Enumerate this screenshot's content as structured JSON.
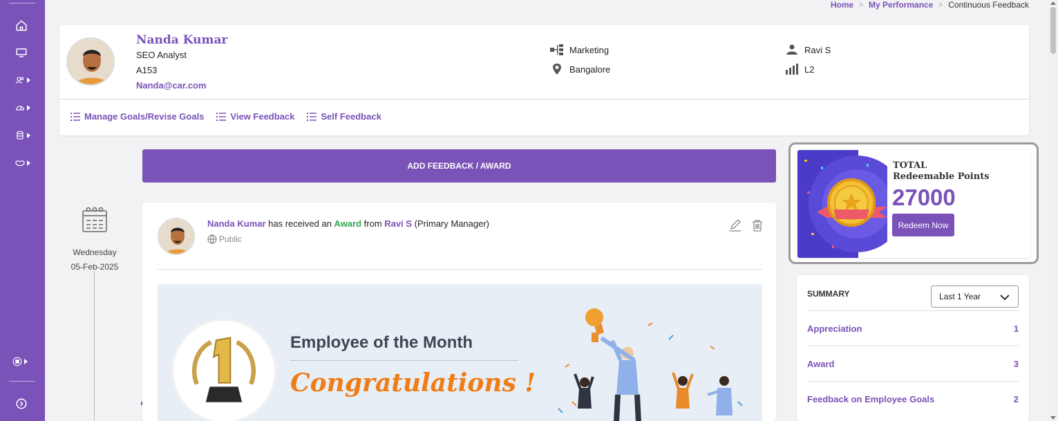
{
  "breadcrumb": {
    "home": "Home",
    "section": "My Performance",
    "current": "Continuous Feedback"
  },
  "profile": {
    "name": "Nanda Kumar",
    "role": "SEO Analyst",
    "id": "A153",
    "email": "Nanda@car.com",
    "department": "Marketing",
    "location": "Bangalore",
    "manager": "Ravi S",
    "level": "L2"
  },
  "profile_links": {
    "manage_goals": "Manage Goals/Revise Goals",
    "view_feedback": "View Feedback",
    "self_feedback": "Self Feedback"
  },
  "add_feedback_label": "ADD FEEDBACK / AWARD",
  "timeline": {
    "weekday": "Wednesday",
    "date": "05-Feb-2025"
  },
  "feed": {
    "recipient": "Nanda Kumar",
    "text1": " has received an ",
    "type": "Award",
    "text2": " from ",
    "giver": "Ravi S",
    "giver_role": " (Primary Manager)",
    "visibility": "Public",
    "banner_title": "Employee of the Month",
    "banner_message": "Congratulations !"
  },
  "points": {
    "label1": "TOTAL",
    "label2": "Redeemable Points",
    "value": "27000",
    "redeem_label": "Redeem Now"
  },
  "summary": {
    "title": "SUMMARY",
    "period": "Last 1 Year",
    "rows": [
      {
        "label": "Appreciation",
        "count": "1"
      },
      {
        "label": "Award",
        "count": "3"
      },
      {
        "label": "Feedback on Employee Goals",
        "count": "2"
      }
    ]
  },
  "colors": {
    "brand": "#7a52b8",
    "award": "#2da84a",
    "accent": "#f07c16"
  },
  "icons": [
    "home-icon",
    "monitor-icon",
    "users-icon",
    "dashboard-icon",
    "database-icon",
    "handshake-icon",
    "apps-icon",
    "expand-icon",
    "org-chart-icon",
    "location-pin-icon",
    "person-icon",
    "level-bars-icon",
    "list-icon",
    "calendar-icon",
    "globe-icon",
    "edit-icon",
    "trash-icon",
    "chevron-down-icon"
  ]
}
